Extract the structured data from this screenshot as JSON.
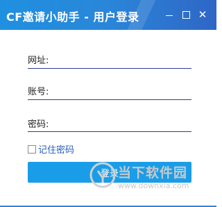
{
  "window": {
    "title": "CF邀请小助手 - 用户登录",
    "controls": {
      "minimize_icon": "minimize-icon",
      "maximize_icon": "maximize-icon",
      "close_icon": "close-icon"
    }
  },
  "form": {
    "url_label": "网址:",
    "url_value": "",
    "account_label": "账号:",
    "account_value": "",
    "password_label": "密码:",
    "password_value": "",
    "remember_label": "记住密码",
    "remember_checked": false,
    "login_label": "登录"
  },
  "watermark": {
    "text": "当下软件园",
    "url": "www.downxia.com"
  },
  "colors": {
    "titlebar": "#2a86d8",
    "accent_button": "#1a9de8",
    "field_underline": "#2b3a9c",
    "remember_text": "#2a5fb8"
  }
}
